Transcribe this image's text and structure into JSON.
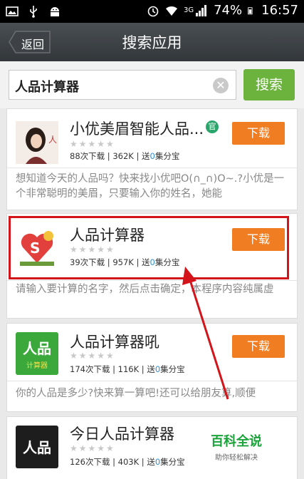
{
  "status_bar": {
    "network": "3G",
    "battery": "74%",
    "time": "16:57"
  },
  "header": {
    "back_label": "返回",
    "title": "搜索应用"
  },
  "search": {
    "value": "人品计算器",
    "button_label": "搜索"
  },
  "results": [
    {
      "name": "小优美眉智能人品...",
      "official_badge": "官",
      "stars": "★★★★★",
      "downloads": "88次下载",
      "size": "362K",
      "reward_prefix": "送",
      "reward_value": "0",
      "reward_suffix": "集分宝",
      "download_label": "下载",
      "description": "想知道今天的人品吗？快来找小优吧O(∩_∩)O~.?小优是一个非常聪明的美眉，只要输入你的姓名，她能"
    },
    {
      "name": "人品计算器",
      "stars": "★★★★★",
      "downloads": "39次下载",
      "size": "957K",
      "reward_prefix": "送",
      "reward_value": "0",
      "reward_suffix": "集分宝",
      "download_label": "下载",
      "description": "请输入要计算的名字，然后点击确定，本程序内容纯属虚"
    },
    {
      "name": "人品计算器吼",
      "stars": "★★★★★",
      "downloads": "174次下载",
      "size": "116K",
      "reward_prefix": "送",
      "reward_value": "0",
      "reward_suffix": "集分宝",
      "download_label": "下载",
      "description": "你的人品是多少?快来算一算吧!还可以给朋友算,顺便"
    },
    {
      "name": "今日人品计算器",
      "stars": "★★★★★",
      "downloads": "126次下载",
      "size": "403K",
      "reward_prefix": "送",
      "reward_value": "0",
      "reward_suffix": "集分宝"
    }
  ],
  "icons": {
    "app3_text_top": "人品",
    "app3_text_bottom": "计算器",
    "app4_text": "人品"
  },
  "watermark": {
    "title": "百科全说",
    "subtitle": "助你轻松解决"
  },
  "colors": {
    "download": "#f07d22",
    "search_button": "#6bb33c",
    "highlight": "#d4141b",
    "reward_value": "#2d8fd5"
  }
}
